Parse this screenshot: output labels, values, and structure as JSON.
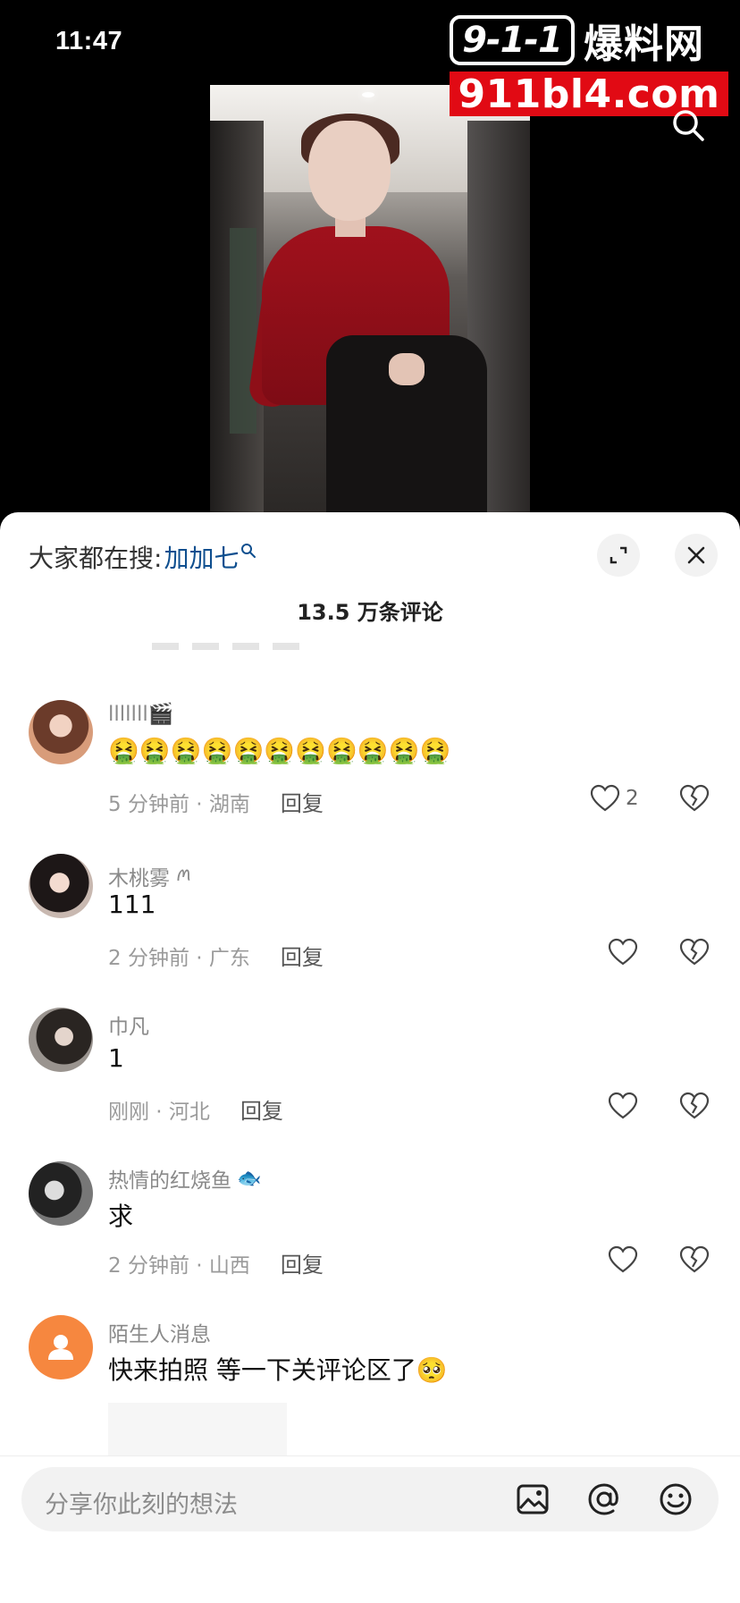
{
  "status_bar": {
    "time": "11:47"
  },
  "logo": {
    "badge": "9-1-1",
    "cn_text": "爆料网",
    "url": "911bl4.com"
  },
  "sheet": {
    "hot_search_prefix": "大家都在搜: ",
    "hot_search_term": "加加七",
    "comment_count": "13.5 万条评论"
  },
  "comments": [
    {
      "user": "lllllll🎬",
      "text": "🤮🤮🤮🤮🤮🤮🤮🤮🤮🤮🤮",
      "time_loc": "5 分钟前 · 湖南",
      "reply": "回复",
      "likes": "2"
    },
    {
      "user": "木桃雾",
      "user_tag": "ꪔ",
      "text": "111",
      "time_loc": "2 分钟前 · 广东",
      "reply": "回复",
      "likes": ""
    },
    {
      "user": "巾凡",
      "text": "1",
      "time_loc": "刚刚 · 河北",
      "reply": "回复",
      "likes": ""
    },
    {
      "user": "热情的红烧鱼",
      "user_tag": "🐟",
      "text": "求",
      "time_loc": "2 分钟前 · 山西",
      "reply": "回复",
      "likes": ""
    },
    {
      "user": "陌生人消息",
      "text": "快来拍照 等一下关评论区了🥺",
      "time_loc": "",
      "reply": "",
      "likes": ""
    }
  ],
  "input": {
    "placeholder": "分享你此刻的想法"
  }
}
